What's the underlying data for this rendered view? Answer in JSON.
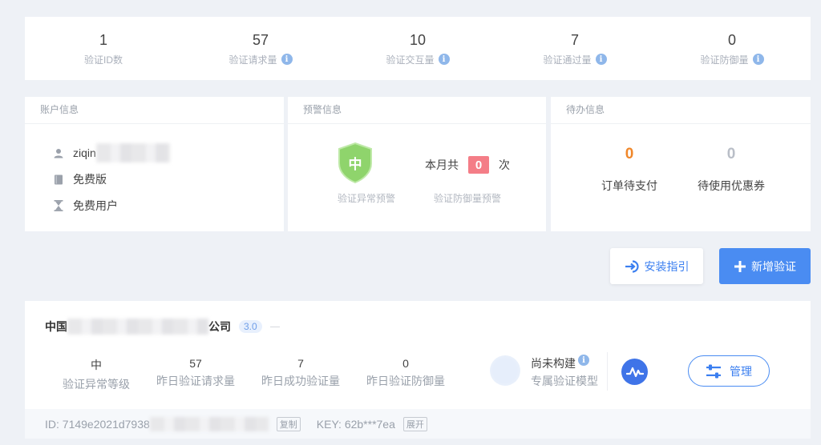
{
  "stats": [
    {
      "value": "1",
      "label": "验证ID数",
      "info": false
    },
    {
      "value": "57",
      "label": "验证请求量",
      "info": true
    },
    {
      "value": "10",
      "label": "验证交互量",
      "info": true
    },
    {
      "value": "7",
      "label": "验证通过量",
      "info": true
    },
    {
      "value": "0",
      "label": "验证防御量",
      "info": true
    }
  ],
  "account": {
    "title": "账户信息",
    "username": "ziqin",
    "plan": "免费版",
    "user_type": "免费用户"
  },
  "warning": {
    "title": "预警信息",
    "level": "中",
    "level_label": "验证异常预警",
    "month_prefix": "本月共",
    "month_count": "0",
    "month_suffix": "次",
    "defense_label": "验证防御量预警",
    "colors": {
      "shield": "#8fd46c",
      "count_badge": "#f47d87"
    }
  },
  "todo": {
    "title": "待办信息",
    "orders_value": "0",
    "orders_label": "订单待支付",
    "coupons_value": "0",
    "coupons_label": "待使用优惠券",
    "colors": {
      "orders": "#f0872a",
      "coupons": "#b9bec7"
    }
  },
  "buttons": {
    "guide": "安装指引",
    "add": "新增验证"
  },
  "app": {
    "company_prefix": "中国",
    "company_suffix": "公司",
    "version": "3.0",
    "metrics": [
      {
        "value": "中",
        "label": "验证异常等级"
      },
      {
        "value": "57",
        "label": "昨日验证请求量"
      },
      {
        "value": "7",
        "label": "昨日成功验证量"
      },
      {
        "value": "0",
        "label": "昨日验证防御量"
      }
    ],
    "model_status": "尚未构建",
    "model_label": "专属验证模型",
    "manage": "管理",
    "id_text": "ID: 7149e2021d7938",
    "copy": "复制",
    "key_text": "KEY: 62b***7ea",
    "expand": "展开"
  },
  "accent_color": "#4a8cf2"
}
